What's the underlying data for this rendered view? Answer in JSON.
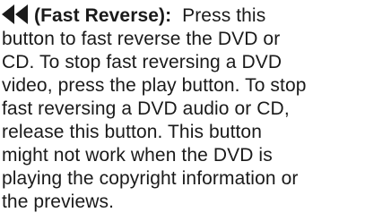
{
  "entry": {
    "icon": "fast-reverse-icon",
    "name": "(Fast Reverse):",
    "lines": [
      "Press this",
      "button to fast reverse the DVD or",
      "CD. To stop fast reversing a DVD",
      "video, press the play button. To stop",
      "fast reversing a DVD audio or CD,",
      "release this button. This button",
      "might not work when the DVD is",
      "playing the copyright information or",
      "the previews."
    ]
  }
}
